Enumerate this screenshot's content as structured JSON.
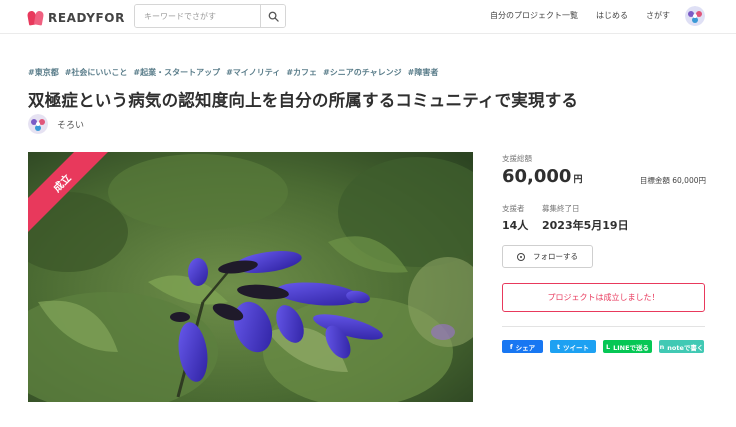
{
  "header": {
    "logo_text": "READYFOR",
    "search_placeholder": "キーワードでさがす",
    "nav": [
      "自分のプロジェクト一覧",
      "はじめる",
      "さがす"
    ]
  },
  "project": {
    "tags": [
      "#東京都",
      "#社会にいいこと",
      "#起業・スタートアップ",
      "#マイノリティ",
      "#カフェ",
      "#シニアのチャレンジ",
      "#障害者"
    ],
    "title": "双極症という病気の認知度向上を自分の所属するコミュニティで実現する",
    "owner_name": "そろい",
    "badge": "成立"
  },
  "stats": {
    "total_label": "支援総額",
    "total_amount": "60,000",
    "currency": "円",
    "goal_text": "目標金額 60,000円",
    "supporters_label": "支援者",
    "supporters_value": "14人",
    "end_label": "募集終了日",
    "end_value": "2023年5月19日"
  },
  "actions": {
    "follow_label": "フォローする",
    "success_message": "プロジェクトは成立しました！",
    "share": [
      {
        "label": "シェア",
        "icon": "f",
        "color": "#1877f2"
      },
      {
        "label": "ツイート",
        "icon": "t",
        "color": "#1da1f2"
      },
      {
        "label": "LINEで送る",
        "icon": "L",
        "color": "#06c755"
      },
      {
        "label": "noteで書く",
        "icon": "n",
        "color": "#41c9b4"
      }
    ]
  },
  "colors": {
    "accent": "#e8395c",
    "tag": "#5a7d8a"
  }
}
